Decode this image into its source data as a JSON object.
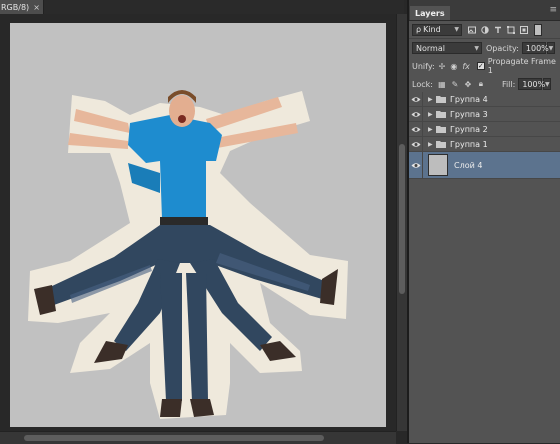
{
  "document": {
    "tab_title": "RGB/8)",
    "close_glyph": "×"
  },
  "panel": {
    "tab_label": "Layers",
    "menu_glyph": "≡",
    "filter": {
      "kind_label": "Kind",
      "kind_prefix": "ρ",
      "icons": [
        "image-filter-icon",
        "adjustment-filter-icon",
        "type-filter-icon",
        "shape-filter-icon",
        "smart-object-filter-icon"
      ]
    },
    "blend_mode": "Normal",
    "opacity_label": "Opacity:",
    "opacity_value": "100%",
    "unify_label": "Unify:",
    "propagate_label": "Propagate Frame 1",
    "lock_label": "Lock:",
    "fill_label": "Fill:",
    "fill_value": "100%",
    "layers": [
      {
        "name": "Группа 4",
        "type": "group",
        "visible": true
      },
      {
        "name": "Группа 3",
        "type": "group",
        "visible": true
      },
      {
        "name": "Группа 2",
        "type": "group",
        "visible": true
      },
      {
        "name": "Группа 1",
        "type": "group",
        "visible": true
      },
      {
        "name": "Слой 4",
        "type": "layer",
        "visible": true,
        "selected": true
      }
    ]
  },
  "colors": {
    "panel_bg": "#535353",
    "canvas_bg": "#c1c1c1",
    "selected_layer": "#5c738e",
    "shirt": "#1e8ccf",
    "jeans": "#31475f"
  }
}
